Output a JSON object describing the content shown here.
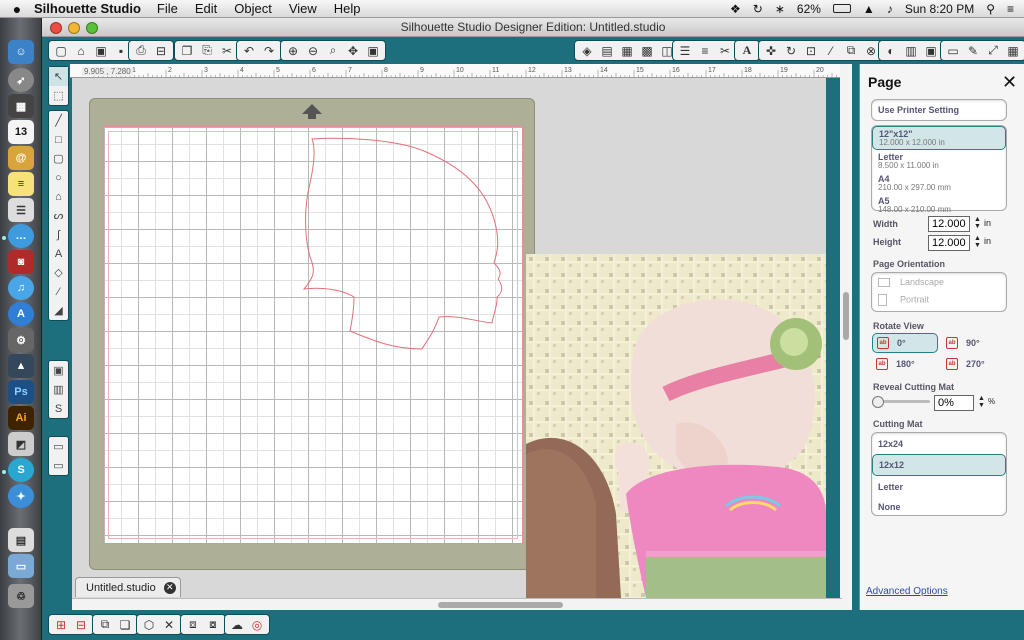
{
  "menubar": {
    "app_name": "Silhouette Studio",
    "menus": [
      "File",
      "Edit",
      "Object",
      "View",
      "Help"
    ],
    "battery": "62%",
    "clock": "Sun 8:20 PM"
  },
  "window": {
    "title": "Silhouette Studio Designer Edition: Untitled.studio"
  },
  "dock": {
    "calendar_day": "13"
  },
  "ruler": {
    "coords": "9.905 , 7.280",
    "top_numbers": [
      "1",
      "2",
      "3",
      "4",
      "5",
      "6",
      "7",
      "8",
      "9",
      "10",
      "11",
      "12",
      "13",
      "14",
      "15",
      "16",
      "17",
      "18",
      "19",
      "20"
    ]
  },
  "document": {
    "tab_label": "Untitled.studio",
    "close_glyph": "✕"
  },
  "panel": {
    "title": "Page",
    "close_glyph": "✕",
    "use_printer_setting": "Use Printer Setting",
    "page_sizes": [
      {
        "name": "12\"x12\"",
        "dims": "12.000 x 12.000 in",
        "selected": true
      },
      {
        "name": "Letter",
        "dims": "8.500 x 11.000 in",
        "selected": false
      },
      {
        "name": "A4",
        "dims": "210.00 x 297.00 mm",
        "selected": false
      },
      {
        "name": "A5",
        "dims": "148.00 x 210.00 mm",
        "selected": false
      }
    ],
    "width_label": "Width",
    "width_value": "12.000",
    "height_label": "Height",
    "height_value": "12.000",
    "unit": "in",
    "orientation_label": "Page Orientation",
    "orientation_options": [
      "Landscape",
      "Portrait"
    ],
    "rotate_label": "Rotate View",
    "rotate_options": [
      "0°",
      "90°",
      "180°",
      "270°"
    ],
    "reveal_label": "Reveal Cutting Mat",
    "reveal_value": "0%",
    "reveal_unit": "%",
    "cutting_mat_label": "Cutting Mat",
    "cutting_mats": [
      "12x24",
      "12x12",
      "Letter",
      "None"
    ],
    "cutting_mat_selected": "12x12",
    "advanced_options": "Advanced Options"
  }
}
